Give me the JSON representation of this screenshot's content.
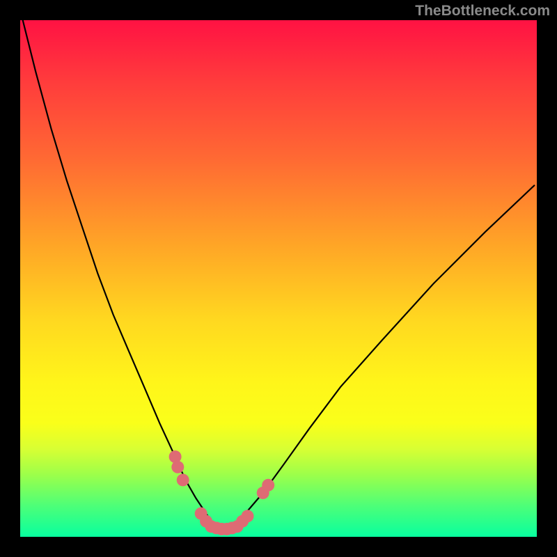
{
  "watermark": "TheBottleneck.com",
  "chart_data": {
    "type": "line",
    "title": "",
    "xlabel": "",
    "ylabel": "",
    "xlim": [
      0,
      100
    ],
    "ylim": [
      0,
      100
    ],
    "grid": false,
    "series": [
      {
        "name": "bottleneck-curve",
        "x": [
          0.5,
          3,
          6,
          9,
          12,
          15,
          18,
          21,
          24,
          27,
          30,
          32,
          34,
          36,
          37,
          38,
          39,
          40,
          41,
          42,
          44,
          47,
          51,
          56,
          62,
          70,
          80,
          90,
          99.5
        ],
        "values": [
          100,
          90,
          79,
          69,
          60,
          51,
          43,
          36,
          29,
          22,
          15.5,
          11,
          7.5,
          4.5,
          3,
          2,
          1.5,
          1.5,
          2,
          2.8,
          5,
          8.5,
          14,
          21,
          29,
          38,
          49,
          59,
          68
        ]
      }
    ],
    "markers": {
      "name": "highlight-dots",
      "color": "#de6b74",
      "points": [
        {
          "x": 30.0,
          "y": 15.5
        },
        {
          "x": 30.5,
          "y": 13.5
        },
        {
          "x": 31.5,
          "y": 11.0
        },
        {
          "x": 35.0,
          "y": 4.5
        },
        {
          "x": 36.0,
          "y": 3.0
        },
        {
          "x": 37.0,
          "y": 2.0
        },
        {
          "x": 38.0,
          "y": 1.7
        },
        {
          "x": 39.0,
          "y": 1.5
        },
        {
          "x": 40.0,
          "y": 1.5
        },
        {
          "x": 41.0,
          "y": 1.7
        },
        {
          "x": 42.0,
          "y": 2.0
        },
        {
          "x": 43.0,
          "y": 3.0
        },
        {
          "x": 44.0,
          "y": 4.0
        },
        {
          "x": 47.0,
          "y": 8.5
        },
        {
          "x": 48.0,
          "y": 10.0
        }
      ]
    }
  }
}
